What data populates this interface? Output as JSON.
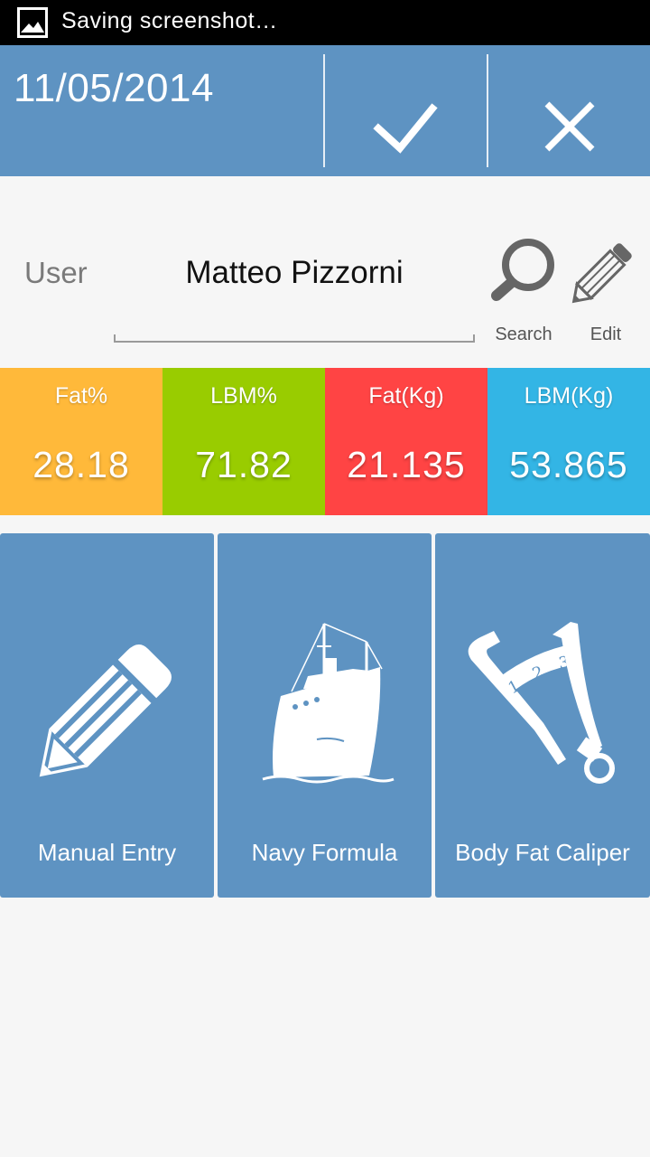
{
  "status_bar": {
    "text": "Saving screenshot…",
    "icon": "image-icon"
  },
  "action_bar": {
    "date": "11/05/2014",
    "confirm_icon": "check-icon",
    "cancel_icon": "close-icon",
    "background_color": "#5e93c2"
  },
  "user_row": {
    "label": "User",
    "name": "Matteo Pizzorni",
    "search_label": "Search",
    "edit_label": "Edit",
    "search_icon": "magnifier-icon",
    "edit_icon": "pencil-icon"
  },
  "stats": [
    {
      "label": "Fat%",
      "value": "28.18",
      "color": "#ffb93a"
    },
    {
      "label": "LBM%",
      "value": "71.82",
      "color": "#99cc00"
    },
    {
      "label": "Fat(Kg)",
      "value": "21.135",
      "color": "#ff4444"
    },
    {
      "label": "LBM(Kg)",
      "value": "53.865",
      "color": "#33b5e5"
    }
  ],
  "methods": [
    {
      "label": "Manual Entry",
      "icon": "pencil-icon"
    },
    {
      "label": "Navy Formula",
      "icon": "ship-icon"
    },
    {
      "label": "Body Fat Caliper",
      "icon": "caliper-icon"
    }
  ]
}
